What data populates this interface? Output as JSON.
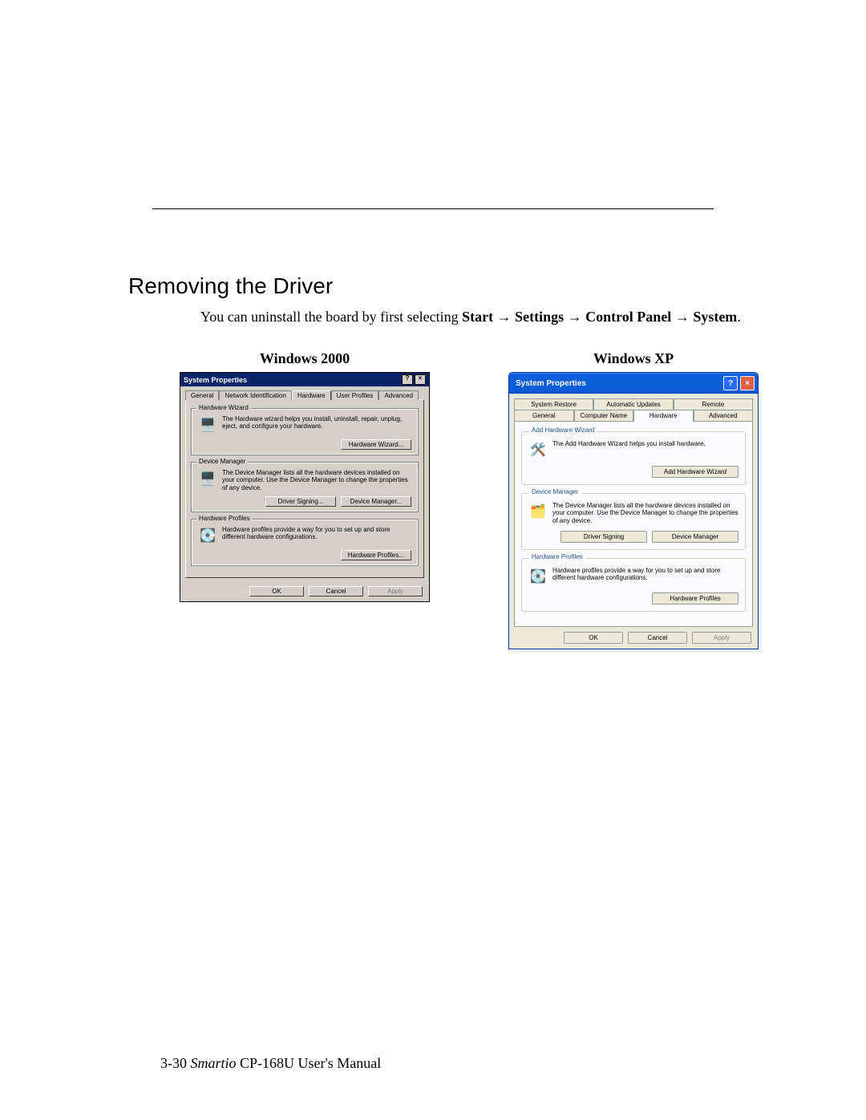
{
  "heading": "Removing the Driver",
  "intro_pre": "You can uninstall the board by first selecting ",
  "path": {
    "start": "Start",
    "settings": "Settings",
    "cp": "Control Panel",
    "system": "System"
  },
  "arrow": "→",
  "col_titles": {
    "w2k": "Windows 2000",
    "xp": "Windows XP"
  },
  "w2k": {
    "title": "System Properties",
    "help": "?",
    "close": "×",
    "tabs": [
      "General",
      "Network Identification",
      "Hardware",
      "User Profiles",
      "Advanced"
    ],
    "hw": {
      "legend": "Hardware Wizard",
      "desc": "The Hardware wizard helps you install, uninstall, repair, unplug, eject, and configure your hardware.",
      "btn": "Hardware Wizard..."
    },
    "dm": {
      "legend": "Device Manager",
      "desc": "The Device Manager lists all the hardware devices installed on your computer. Use the Device Manager to change the properties of any device.",
      "btn1": "Driver Signing...",
      "btn2": "Device Manager..."
    },
    "hp": {
      "legend": "Hardware Profiles",
      "desc": "Hardware profiles provide a way for you to set up and store different hardware configurations.",
      "btn": "Hardware Profiles..."
    },
    "ok": "OK",
    "cancel": "Cancel",
    "apply": "Apply"
  },
  "xp": {
    "title": "System Properties",
    "help": "?",
    "close": "×",
    "tabs_row1": [
      "System Restore",
      "Automatic Updates",
      "Remote"
    ],
    "tabs_row2": [
      "General",
      "Computer Name",
      "Hardware",
      "Advanced"
    ],
    "hw": {
      "legend": "Add Hardware Wizard",
      "desc": "The Add Hardware Wizard helps you install hardware.",
      "btn": "Add Hardware Wizard"
    },
    "dm": {
      "legend": "Device Manager",
      "desc": "The Device Manager lists all the hardware devices installed on your computer. Use the Device Manager to change the properties of any device.",
      "btn1": "Driver Signing",
      "btn2": "Device Manager"
    },
    "hp": {
      "legend": "Hardware Profiles",
      "desc": "Hardware profiles provide a way for you to set up and store different hardware configurations.",
      "btn": "Hardware Profiles"
    },
    "ok": "OK",
    "cancel": "Cancel",
    "apply": "Apply"
  },
  "footer": {
    "page": "3-30",
    "brand": "Smartio",
    "rest": " CP-168U User's Manual"
  }
}
